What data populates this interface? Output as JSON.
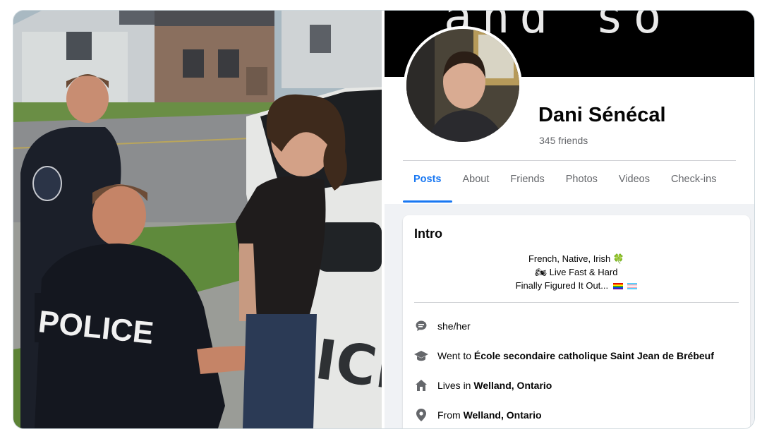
{
  "profile": {
    "name": "Dani Sénécal",
    "friends": "345 friends",
    "cover_text": "and so"
  },
  "tabs": [
    {
      "label": "Posts",
      "active": true
    },
    {
      "label": "About"
    },
    {
      "label": "Friends"
    },
    {
      "label": "Photos"
    },
    {
      "label": "Videos"
    },
    {
      "label": "Check-ins"
    }
  ],
  "intro": {
    "title": "Intro",
    "bio_line1": "French, Native, Irish 🍀",
    "bio_line2": "Live Fast & Hard",
    "bio_line3": "Finally Figured It Out...",
    "pronouns": "she/her",
    "education_prefix": "Went to ",
    "education_value": "École secondaire catholique Saint Jean de Brébeuf",
    "lives_prefix": "Lives in ",
    "lives_value": "Welland, Ontario",
    "from_prefix": "From ",
    "from_value": "Welland, Ontario"
  },
  "photo": {
    "vest_text": "POLICE",
    "car_text": "ICE"
  },
  "colors": {
    "accent": "#1877f2",
    "icon": "#65676b",
    "background": "#f0f2f5"
  },
  "icons": [
    "chat-bubble-icon",
    "graduation-cap-icon",
    "house-icon",
    "location-pin-icon",
    "clover-emoji",
    "motorcycle-emoji",
    "pride-flag-icon",
    "trans-flag-icon"
  ]
}
